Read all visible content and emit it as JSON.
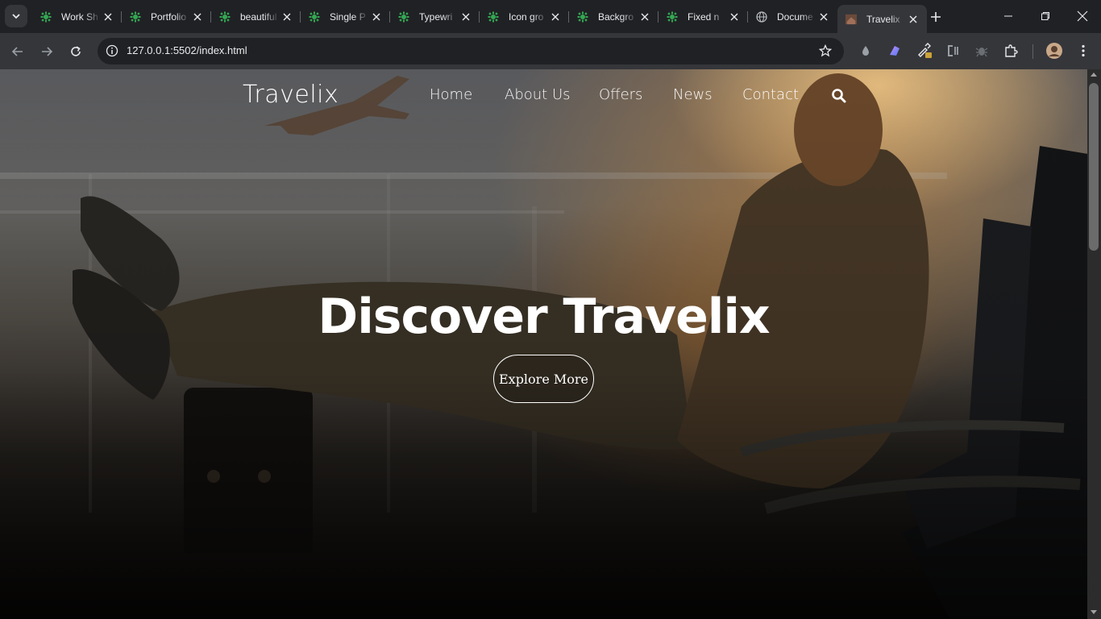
{
  "browser": {
    "tabs": [
      {
        "title": "Work Sh",
        "favicon": "green-gear-icon",
        "active": false
      },
      {
        "title": "Portfolio",
        "favicon": "green-gear-icon",
        "active": false
      },
      {
        "title": "beautiful",
        "favicon": "green-gear-icon",
        "active": false
      },
      {
        "title": "Single P",
        "favicon": "green-gear-icon",
        "active": false
      },
      {
        "title": "Typewri",
        "favicon": "green-gear-icon",
        "active": false
      },
      {
        "title": "Icon gro",
        "favicon": "green-gear-icon",
        "active": false
      },
      {
        "title": "Backgro",
        "favicon": "green-gear-icon",
        "active": false
      },
      {
        "title": "Fixed n",
        "favicon": "green-gear-icon",
        "active": false
      },
      {
        "title": "Docume",
        "favicon": "globe-icon",
        "active": false
      },
      {
        "title": "Travelix",
        "favicon": "site-thumbnail-icon",
        "active": true
      }
    ],
    "url": "127.0.0.1:5502/index.html",
    "colors": {
      "tabstrip": "#202124",
      "toolbar": "#35363a",
      "omnibox": "#202124",
      "text": "#e8eaed",
      "favicon_green": "#34a853"
    }
  },
  "site": {
    "logo": "Travelix",
    "nav": [
      "Home",
      "About Us",
      "Offers",
      "News",
      "Contact"
    ],
    "hero_title": "Discover Travelix",
    "hero_button": "Explore More"
  }
}
